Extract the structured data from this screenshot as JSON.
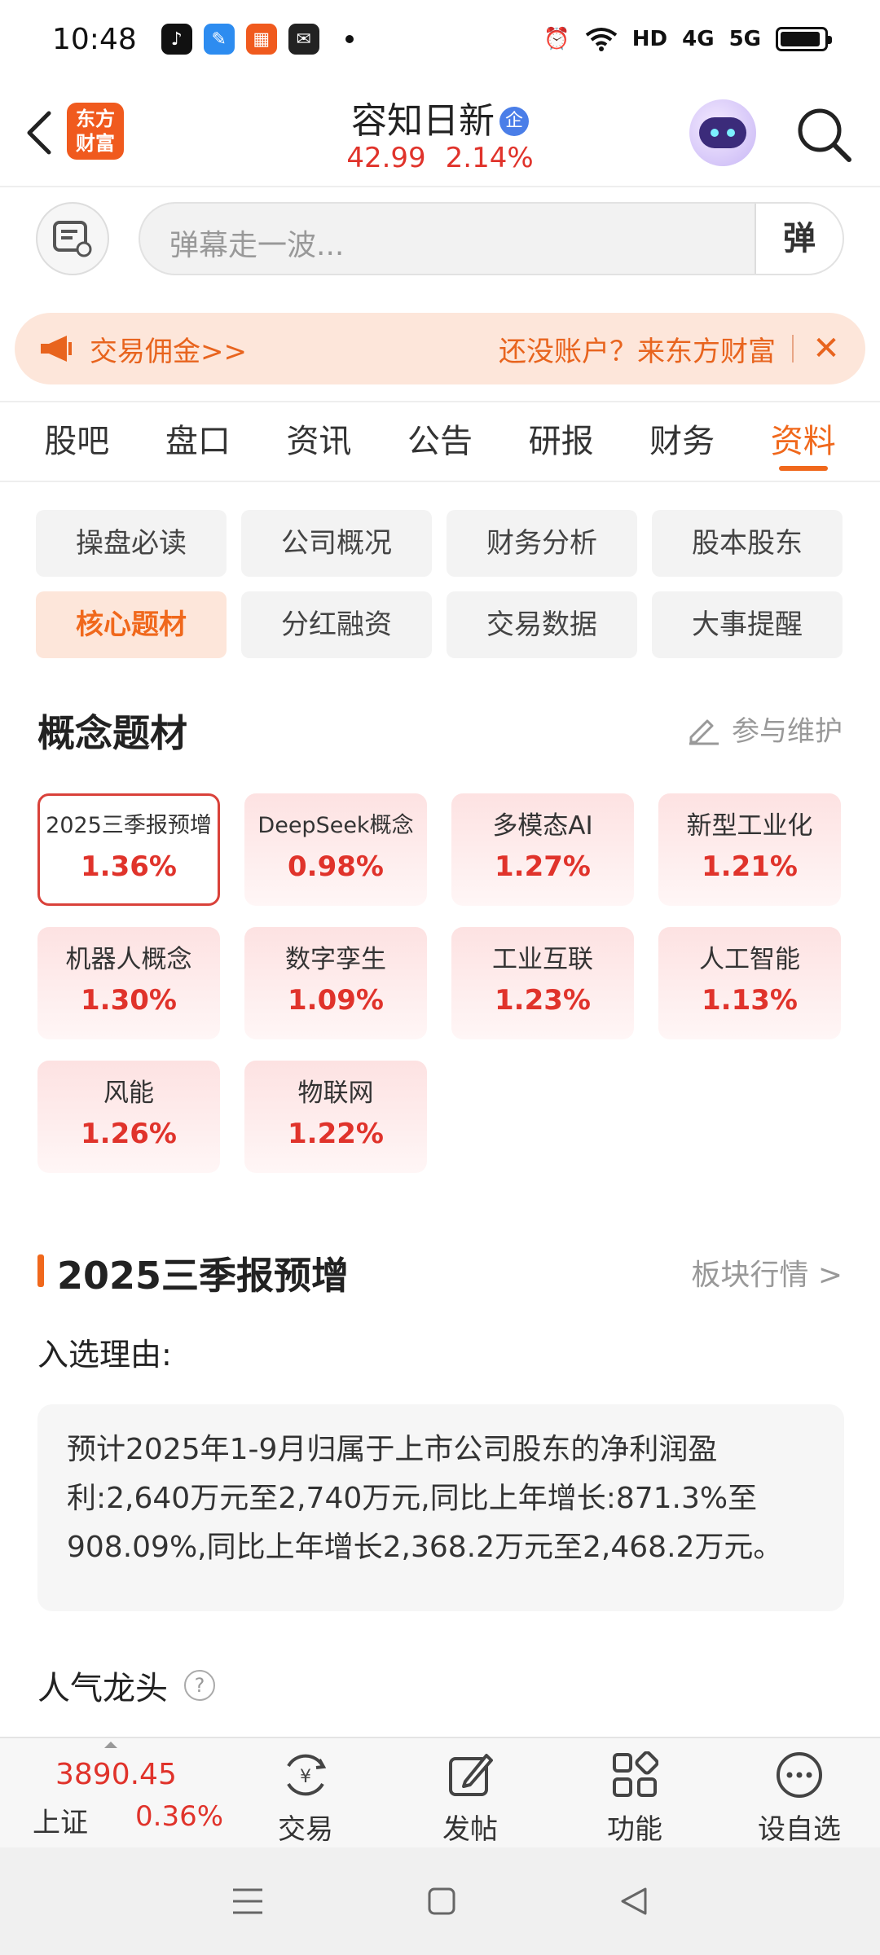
{
  "status_bar": {
    "time": "10:48",
    "network_labels": [
      "HD",
      "4G",
      "5G"
    ]
  },
  "header": {
    "logo_text": "东方财富",
    "stock_name": "容知日新",
    "cert_badge": "企",
    "price": "42.99",
    "change_pct": "2.14%"
  },
  "barrage": {
    "placeholder": "弹幕走一波...",
    "send_label": "弹"
  },
  "promo": {
    "left_text": "交易佣金>>",
    "right_text": "还没账户？来东方财富"
  },
  "tabs": [
    "股吧",
    "盘口",
    "资讯",
    "公告",
    "研报",
    "财务",
    "资料"
  ],
  "sub_buttons": [
    "操盘必读",
    "公司概况",
    "财务分析",
    "股本股东",
    "核心题材",
    "分红融资",
    "交易数据",
    "大事提醒"
  ],
  "concept_section": {
    "title": "概念题材",
    "maintain_label": "参与维护",
    "items": [
      {
        "name": "2025三季报预增",
        "pct": "1.36%"
      },
      {
        "name": "DeepSeek概念",
        "pct": "0.98%"
      },
      {
        "name": "多模态AI",
        "pct": "1.27%"
      },
      {
        "name": "新型工业化",
        "pct": "1.21%"
      },
      {
        "name": "机器人概念",
        "pct": "1.30%"
      },
      {
        "name": "数字孪生",
        "pct": "1.09%"
      },
      {
        "name": "工业互联",
        "pct": "1.23%"
      },
      {
        "name": "人工智能",
        "pct": "1.13%"
      },
      {
        "name": "风能",
        "pct": "1.26%"
      },
      {
        "name": "物联网",
        "pct": "1.22%"
      }
    ]
  },
  "detail_section": {
    "title": "2025三季报预增",
    "link_label": "板块行情 >",
    "reason_label": "入选理由:",
    "reason_text": "预计2025年1-9月归属于上市公司股东的净利润盈利:2,640万元至2,740万元,同比上年增长:871.3%至908.09%,同比上年增长2,368.2万元至2,468.2万元。",
    "popular_label": "人气龙头",
    "help_mark": "?"
  },
  "bottom_bar": {
    "index_value": "3890.45",
    "index_name": "上证",
    "index_pct": "0.36%",
    "items": [
      "交易",
      "发帖",
      "功能",
      "设自选"
    ]
  },
  "colors": {
    "accent": "#f0681c",
    "up_red": "#e0332b",
    "promo_bg": "#fde6da"
  }
}
